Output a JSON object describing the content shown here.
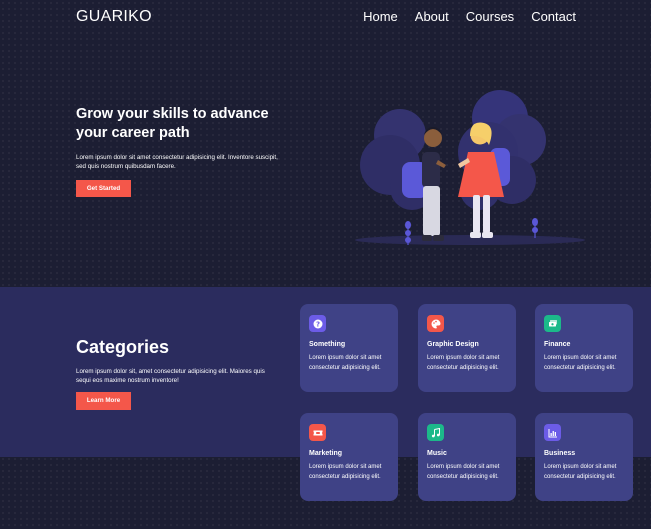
{
  "nav": {
    "logo": "GUARIKO",
    "links": [
      "Home",
      "About",
      "Courses",
      "Contact"
    ]
  },
  "hero": {
    "title": "Grow your skills to advance your career path",
    "description": "Lorem ipsum dolor sit amet consectetur adipisicing elit. Inventore suscipit, sed quis nostrum quibusdam facere.",
    "button": "Get Started"
  },
  "categories": {
    "title": "Categories",
    "description": "Lorem ipsum dolor sit, amet consectetur adipisicing elit. Maiores quis sequi eos maxime nostrum inventore!",
    "button": "Learn More",
    "cards": [
      {
        "title": "Something",
        "description": "Lorem ipsum dolor sit amet consectetur adipisicing elit.",
        "icon": "question-icon",
        "color": "#6c5ce7"
      },
      {
        "title": "Graphic Design",
        "description": "Lorem ipsum dolor sit amet consectetur adipisicing elit.",
        "icon": "palette-icon",
        "color": "#f4574a"
      },
      {
        "title": "Finance",
        "description": "Lorem ipsum dolor sit amet consectetur adipisicing elit.",
        "icon": "money-icon",
        "color": "#1cb98a"
      },
      {
        "title": "Marketing",
        "description": "Lorem ipsum dolor sit amet consectetur adipisicing elit.",
        "icon": "ticket-icon",
        "color": "#f4574a"
      },
      {
        "title": "Music",
        "description": "Lorem ipsum dolor sit amet consectetur adipisicing elit.",
        "icon": "music-icon",
        "color": "#1cb98a"
      },
      {
        "title": "Business",
        "description": "Lorem ipsum dolor sit amet consectetur adipisicing elit.",
        "icon": "chart-icon",
        "color": "#6c5ce7"
      }
    ]
  },
  "colors": {
    "background": "#1c1e33",
    "band": "#2b2c5e",
    "card": "#3f4286",
    "accent": "#f4574a"
  }
}
